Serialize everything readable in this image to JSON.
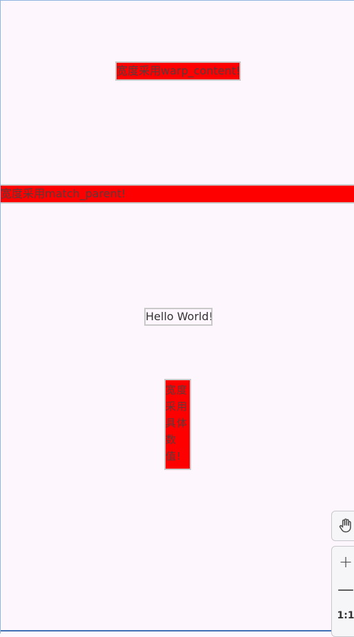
{
  "views": {
    "wrap_text": "宽度采用warp_content!",
    "match_text": "宽度采用match_parent!",
    "hello_text": "Hello World!",
    "fixed_text": "宽度采用具体数值!"
  },
  "toolbar": {
    "pan_icon": "hand-pan-icon",
    "zoom_in_label": "+",
    "zoom_out_label": "—",
    "reset_label": "1:1"
  },
  "colors": {
    "background": "#fdf6fc",
    "highlight": "#ff0000",
    "text": "#5a3a3a"
  }
}
